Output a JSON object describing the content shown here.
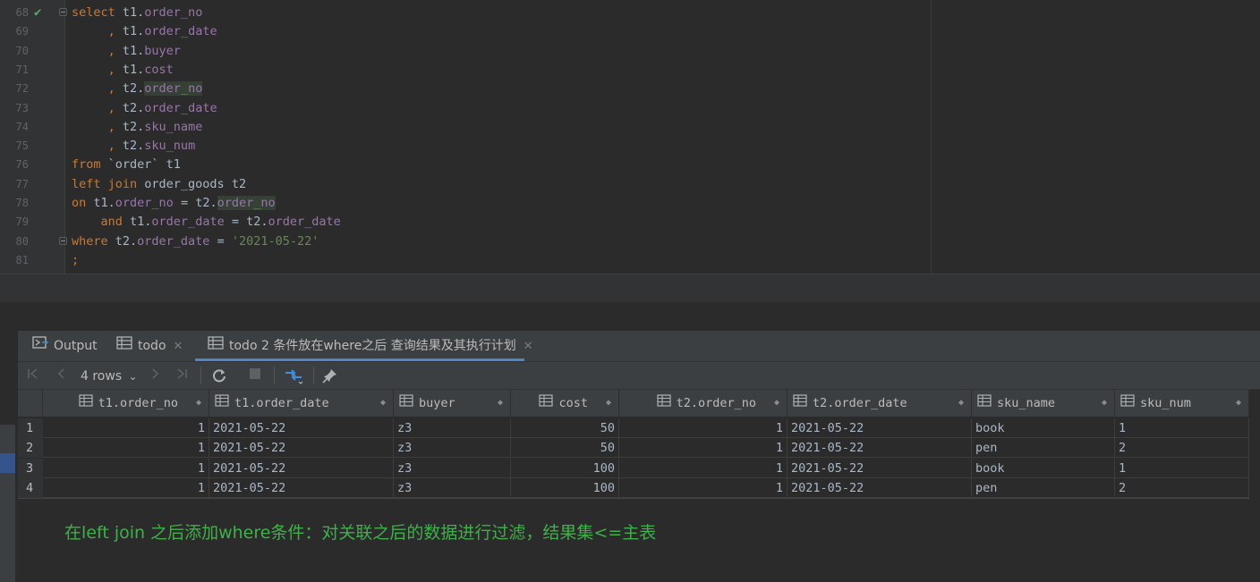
{
  "editor": {
    "lines": [
      {
        "num": "68",
        "tokens": [
          [
            "kw",
            "select"
          ],
          [
            "plain",
            " t1."
          ],
          [
            "fld",
            "order_no"
          ]
        ]
      },
      {
        "num": "69",
        "tokens": [
          [
            "plain",
            "     "
          ],
          [
            "kw",
            ","
          ],
          [
            "plain",
            " t1."
          ],
          [
            "fld",
            "order_date"
          ]
        ]
      },
      {
        "num": "70",
        "tokens": [
          [
            "plain",
            "     "
          ],
          [
            "kw",
            ","
          ],
          [
            "plain",
            " t1."
          ],
          [
            "fld",
            "buyer"
          ]
        ]
      },
      {
        "num": "71",
        "tokens": [
          [
            "plain",
            "     "
          ],
          [
            "kw",
            ","
          ],
          [
            "plain",
            " t1."
          ],
          [
            "fld",
            "cost"
          ]
        ]
      },
      {
        "num": "72",
        "tokens": [
          [
            "plain",
            "     "
          ],
          [
            "kw",
            ","
          ],
          [
            "plain",
            " t2."
          ],
          [
            "fld hl",
            "order_no"
          ]
        ]
      },
      {
        "num": "73",
        "tokens": [
          [
            "plain",
            "     "
          ],
          [
            "kw",
            ","
          ],
          [
            "plain",
            " t2."
          ],
          [
            "fld",
            "order_date"
          ]
        ]
      },
      {
        "num": "74",
        "tokens": [
          [
            "plain",
            "     "
          ],
          [
            "kw",
            ","
          ],
          [
            "plain",
            " t2."
          ],
          [
            "fld",
            "sku_name"
          ]
        ]
      },
      {
        "num": "75",
        "tokens": [
          [
            "plain",
            "     "
          ],
          [
            "kw",
            ","
          ],
          [
            "plain",
            " t2."
          ],
          [
            "fld",
            "sku_num"
          ]
        ]
      },
      {
        "num": "76",
        "tokens": [
          [
            "kw",
            "from"
          ],
          [
            "plain",
            " `order` t1"
          ]
        ]
      },
      {
        "num": "77",
        "tokens": [
          [
            "kw",
            "left join"
          ],
          [
            "plain",
            " order_goods t2"
          ]
        ]
      },
      {
        "num": "78",
        "tokens": [
          [
            "kw",
            "on"
          ],
          [
            "plain",
            " t1."
          ],
          [
            "fld",
            "order_no"
          ],
          [
            "plain",
            " = t2."
          ],
          [
            "fld hl",
            "order_no"
          ]
        ]
      },
      {
        "num": "79",
        "tokens": [
          [
            "plain",
            "    "
          ],
          [
            "kw",
            "and"
          ],
          [
            "plain",
            " t1."
          ],
          [
            "fld",
            "order_date"
          ],
          [
            "plain",
            " = t2."
          ],
          [
            "fld",
            "order_date"
          ]
        ]
      },
      {
        "num": "80",
        "tokens": [
          [
            "kw",
            "where"
          ],
          [
            "plain",
            " t2."
          ],
          [
            "fld",
            "order_date"
          ],
          [
            "plain",
            " = "
          ],
          [
            "str",
            "'2021-05-22'"
          ]
        ]
      },
      {
        "num": "81",
        "tokens": [
          [
            "kw",
            ";"
          ]
        ]
      }
    ],
    "check_icon": "✔"
  },
  "tabs": [
    {
      "label": "Output",
      "icon": "console-icon"
    },
    {
      "label": "todo",
      "icon": "table-icon",
      "close": "✕"
    },
    {
      "label": "todo 2 条件放在where之后 查询结果及其执行计划",
      "icon": "table-icon",
      "close": "✕"
    }
  ],
  "toolbar": {
    "rows_label": "4 rows",
    "rows_caret": "⌄"
  },
  "grid": {
    "columns": [
      {
        "label": "t1.order_no",
        "align": "right"
      },
      {
        "label": "t1.order_date",
        "align": "left"
      },
      {
        "label": "buyer",
        "align": "left"
      },
      {
        "label": "cost",
        "align": "right"
      },
      {
        "label": "t2.order_no",
        "align": "right"
      },
      {
        "label": "t2.order_date",
        "align": "left"
      },
      {
        "label": "sku_name",
        "align": "left"
      },
      {
        "label": "sku_num",
        "align": "left"
      }
    ],
    "rows": [
      {
        "num": "1",
        "cells": [
          "1",
          "2021-05-22",
          "z3",
          "50",
          "1",
          "2021-05-22",
          "book",
          "1"
        ]
      },
      {
        "num": "2",
        "cells": [
          "1",
          "2021-05-22",
          "z3",
          "50",
          "1",
          "2021-05-22",
          "pen",
          "2"
        ]
      },
      {
        "num": "3",
        "cells": [
          "1",
          "2021-05-22",
          "z3",
          "100",
          "1",
          "2021-05-22",
          "book",
          "1"
        ]
      },
      {
        "num": "4",
        "cells": [
          "1",
          "2021-05-22",
          "z3",
          "100",
          "1",
          "2021-05-22",
          "pen",
          "2"
        ]
      }
    ],
    "sort_glyph": "◆"
  },
  "note": "在left join 之后添加where条件：对关联之后的数据进行过滤，结果集<=主表"
}
